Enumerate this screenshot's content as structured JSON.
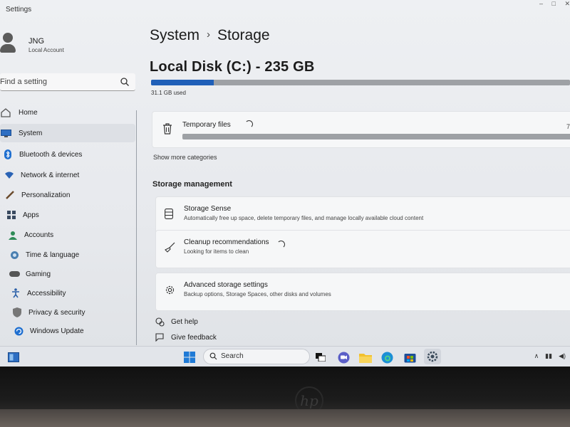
{
  "app": {
    "title": "Settings",
    "controls": [
      "–",
      "□",
      "✕"
    ]
  },
  "user": {
    "name": "JNG",
    "account_type": "Local Account"
  },
  "search": {
    "placeholder": "Find a setting"
  },
  "nav": {
    "items": [
      {
        "label": "Home",
        "icon": "home-icon"
      },
      {
        "label": "System",
        "icon": "monitor-icon",
        "active": true
      },
      {
        "label": "Bluetooth & devices",
        "icon": "bluetooth-icon"
      },
      {
        "label": "Network & internet",
        "icon": "wifi-icon"
      },
      {
        "label": "Personalization",
        "icon": "brush-icon"
      },
      {
        "label": "Apps",
        "icon": "apps-icon"
      },
      {
        "label": "Accounts",
        "icon": "person-icon"
      },
      {
        "label": "Time & language",
        "icon": "globe-clock-icon"
      },
      {
        "label": "Gaming",
        "icon": "gamepad-icon"
      },
      {
        "label": "Accessibility",
        "icon": "accessibility-icon"
      },
      {
        "label": "Privacy & security",
        "icon": "shield-icon"
      },
      {
        "label": "Windows Update",
        "icon": "update-icon"
      }
    ]
  },
  "breadcrumb": {
    "parent": "System",
    "separator": "›",
    "current": "Storage"
  },
  "disk": {
    "title": "Local Disk (C:) - 235 GB",
    "used_text": "31.1 GB used",
    "used_fraction": 0.15,
    "bar_color": "#1f5fb8"
  },
  "temp": {
    "label": "Temporary files",
    "value_partial": "7"
  },
  "show_more": "Show more categories",
  "management": {
    "heading": "Storage management",
    "items": [
      {
        "title": "Storage Sense",
        "desc": "Automatically free up space, delete temporary files, and manage locally available cloud content",
        "icon": "storage-icon"
      },
      {
        "title": "Cleanup recommendations",
        "desc": "Looking for items to clean",
        "icon": "broom-icon"
      },
      {
        "title": "Advanced storage settings",
        "desc": "Backup options, Storage Spaces, other disks and volumes",
        "icon": "gear-icon"
      }
    ]
  },
  "help": {
    "get_help": "Get help",
    "give_feedback": "Give feedback"
  },
  "taskbar": {
    "search_label": "Search"
  },
  "bezel": {
    "logo": "hp"
  }
}
